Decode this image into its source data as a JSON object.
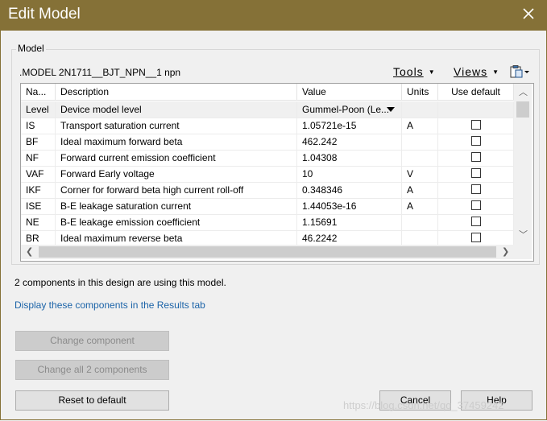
{
  "window": {
    "title": "Edit Model"
  },
  "group": {
    "label": "Model"
  },
  "model": {
    "line": ".MODEL 2N1711__BJT_NPN__1 npn",
    "tools_label": "Tools",
    "views_label": "Views"
  },
  "table": {
    "columns": [
      "Na...",
      "Description",
      "Value",
      "Units",
      "Use default"
    ],
    "rows": [
      {
        "name": "Level",
        "desc": "Device model level",
        "value": "Gummel-Poon (Le...",
        "units": ""
      },
      {
        "name": "IS",
        "desc": "Transport saturation current",
        "value": "1.05721e-15",
        "units": "A"
      },
      {
        "name": "BF",
        "desc": "Ideal maximum forward beta",
        "value": "462.242",
        "units": ""
      },
      {
        "name": "NF",
        "desc": "Forward current emission coefficient",
        "value": "1.04308",
        "units": ""
      },
      {
        "name": "VAF",
        "desc": "Forward Early voltage",
        "value": "10",
        "units": "V"
      },
      {
        "name": "IKF",
        "desc": "Corner for forward beta high current roll-off",
        "value": "0.348346",
        "units": "A"
      },
      {
        "name": "ISE",
        "desc": "B-E leakage saturation current",
        "value": "1.44053e-16",
        "units": "A"
      },
      {
        "name": "NE",
        "desc": "B-E leakage emission coefficient",
        "value": "1.15691",
        "units": ""
      },
      {
        "name": "BR",
        "desc": "Ideal maximum reverse beta",
        "value": "46.2242",
        "units": ""
      }
    ]
  },
  "info": {
    "text": "2 components in this design are using this model."
  },
  "link": {
    "text": "Display these components in the Results tab"
  },
  "buttons": {
    "change_component": "Change component",
    "change_all": "Change all 2 components",
    "reset": "Reset to default",
    "cancel": "Cancel",
    "help": "Help"
  },
  "watermark": {
    "text": "https://blog.csdn.net/qq_37459242"
  },
  "colors": {
    "titlebar": "#857137",
    "link": "#1b63a8"
  },
  "icons": {
    "close": "close-icon",
    "clipboard": "clipboard-icon"
  }
}
